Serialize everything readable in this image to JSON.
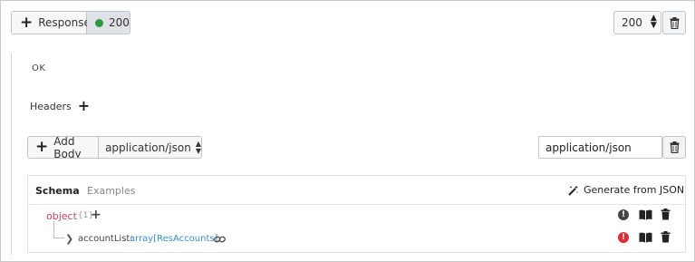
{
  "toolbar": {
    "response_label": "Response",
    "status_code": "200",
    "status_color": "#2a9a3e",
    "status_select_value": "200"
  },
  "response": {
    "description": "OK"
  },
  "headers": {
    "label": "Headers"
  },
  "body": {
    "add_body_label": "Add Body",
    "content_type_select": "application/json",
    "content_type_input": "application/json"
  },
  "schema_panel": {
    "tabs": [
      {
        "label": "Schema",
        "active": true
      },
      {
        "label": "Examples",
        "active": false
      }
    ],
    "generate_label": "Generate from JSON",
    "root": {
      "type": "object",
      "count": "{1}"
    },
    "properties": [
      {
        "name": "accountList",
        "separator": ":",
        "type": "array[ResAccounts]"
      }
    ]
  },
  "icons": {
    "plus": "plus-icon",
    "trash": "trash-icon",
    "sort": "sort-updown-icon",
    "wand": "magic-wand-icon",
    "info": "exclamation-circle-icon",
    "book": "book-icon",
    "link": "link-icon",
    "chevron": "chevron-right-icon"
  },
  "colors": {
    "accent_blue": "#3a8fd6",
    "object_red": "#d0455a",
    "error_red": "#e02b37"
  }
}
